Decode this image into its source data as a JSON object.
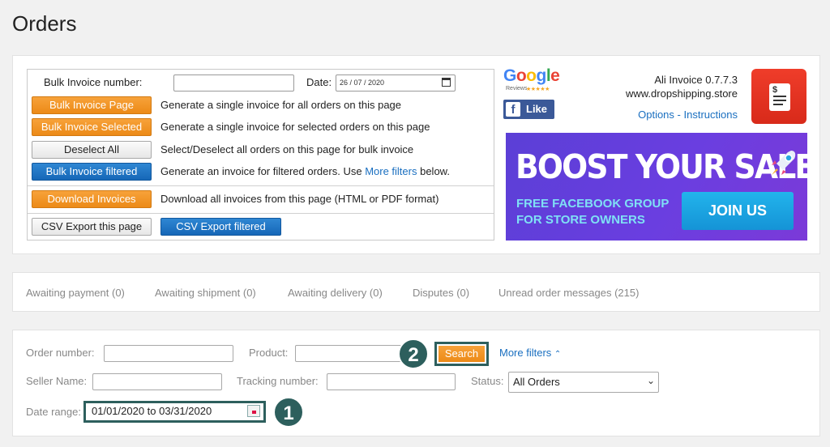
{
  "page": {
    "title": "Orders"
  },
  "invoice": {
    "bulk_invoice_number_label": "Bulk Invoice number:",
    "bulk_invoice_number_value": "",
    "date_label": "Date:",
    "date_value": "26 / 07 / 2020",
    "rows": [
      {
        "button": "Bulk Invoice Page",
        "description": "Generate a single invoice for all orders on this page"
      },
      {
        "button": "Bulk Invoice Selected",
        "description": "Generate a single invoice for selected orders on this page"
      },
      {
        "button": "Deselect All",
        "description": "Select/Deselect all orders on this page for bulk invoice"
      },
      {
        "button": "Bulk Invoice filtered",
        "description_prefix": "Generate an invoice for filtered orders. Use ",
        "description_link": "More filters",
        "description_suffix": " below."
      },
      {
        "button": "Download Invoices",
        "description": "Download all invoices from this page (HTML or PDF format)"
      }
    ],
    "csv_export_page": "CSV Export this page",
    "csv_export_filtered": "CSV Export filtered"
  },
  "branding": {
    "google": "Google",
    "reviews": "Reviews",
    "stars": "★★★★★",
    "fb_like": "Like",
    "version": "Ali Invoice 0.7.7.3",
    "website": "www.dropshipping.store",
    "options": "Options",
    "separator": "-",
    "instructions": "Instructions",
    "banner_title": "BOOST YOUR SALES",
    "banner_sub_1": "FREE FACEBOOK GROUP",
    "banner_sub_2": "FOR STORE OWNERS",
    "join_button": "JOIN US"
  },
  "tabs": [
    "Awaiting payment (0)",
    "Awaiting shipment (0)",
    "Awaiting delivery (0)",
    "Disputes (0)",
    "Unread order messages (215)"
  ],
  "filters": {
    "order_number_label": "Order number:",
    "product_label": "Product:",
    "search_button": "Search",
    "more_filters": "More filters",
    "more_filters_chevron": "⌃",
    "seller_name_label": "Seller Name:",
    "tracking_number_label": "Tracking number:",
    "status_label": "Status:",
    "status_value": "All Orders",
    "date_range_label": "Date range:",
    "date_range_value": "01/01/2020 to 03/31/2020",
    "step_search": "2",
    "step_date": "1"
  },
  "colors": {
    "orange": "#ec8a17",
    "blue": "#1667b7",
    "highlight": "#2d5f5d",
    "link": "#1a6fc0",
    "banner": "#5b3fd6"
  }
}
